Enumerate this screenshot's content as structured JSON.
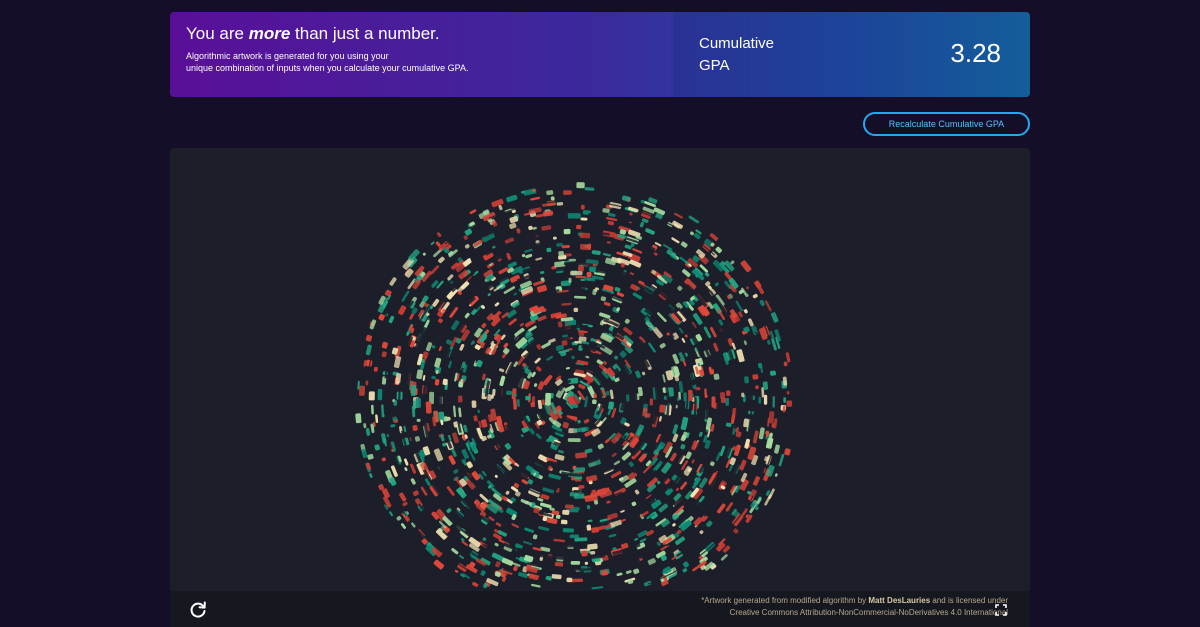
{
  "banner": {
    "headline_prefix": "You are ",
    "headline_emphasis": "more",
    "headline_suffix": " than just a number.",
    "subtext_line1": "Algorithmic artwork is generated for you using your",
    "subtext_line2": "unique combination of inputs when you calculate your cumulative GPA.",
    "gpa_label_line1": "Cumulative",
    "gpa_label_line2": "GPA",
    "gpa_value": "3.28"
  },
  "actions": {
    "recalculate_label": "Recalculate Cumulative GPA"
  },
  "artwork": {
    "palette": [
      "#0e8a74",
      "#e2483a",
      "#f6e5b5",
      "#a6dca0",
      "#22a883",
      "#cf3e35"
    ],
    "background": "#1c1f2a",
    "credit_prefix": "*Artwork generated from modified algorithm by ",
    "credit_author": "Matt DesLauries",
    "credit_middle": " and is licensed under",
    "credit_license": "Creative Commons Attribution-NonCommercial-NoDerivatives 4.0 International",
    "refresh_icon": "refresh-icon",
    "fullscreen_icon": "fullscreen-icon"
  }
}
